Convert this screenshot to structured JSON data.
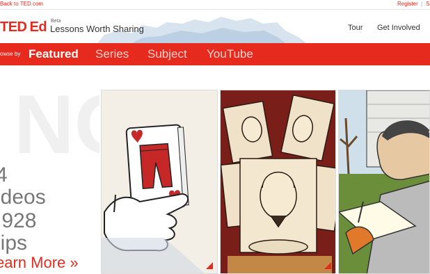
{
  "topbar": {
    "back_link": "Back to TED.com",
    "register": "Register",
    "sep": "|",
    "second_link": "S"
  },
  "header": {
    "logo_ted": "TED",
    "logo_ed": "Ed",
    "beta": "Beta",
    "tagline": "Lessons Worth Sharing",
    "nav": [
      "Tour",
      "Get Involved"
    ]
  },
  "navbar": {
    "browse_label": "owse by",
    "items": [
      "Featured",
      "Series",
      "Subject",
      "YouTube"
    ],
    "active": "Featured"
  },
  "stats": {
    "ghost": "NO",
    "videos_count": "4",
    "videos_label": "ideos",
    "clips_count": ",928",
    "clips_label": "lips",
    "learn_more": "earn More »"
  },
  "colors": {
    "accent": "#e62b1e"
  },
  "tiles": [
    {
      "icon": "playing-card-illustration"
    },
    {
      "icon": "shakespeare-portraits-illustration"
    },
    {
      "icon": "scientist-reading-illustration"
    }
  ]
}
